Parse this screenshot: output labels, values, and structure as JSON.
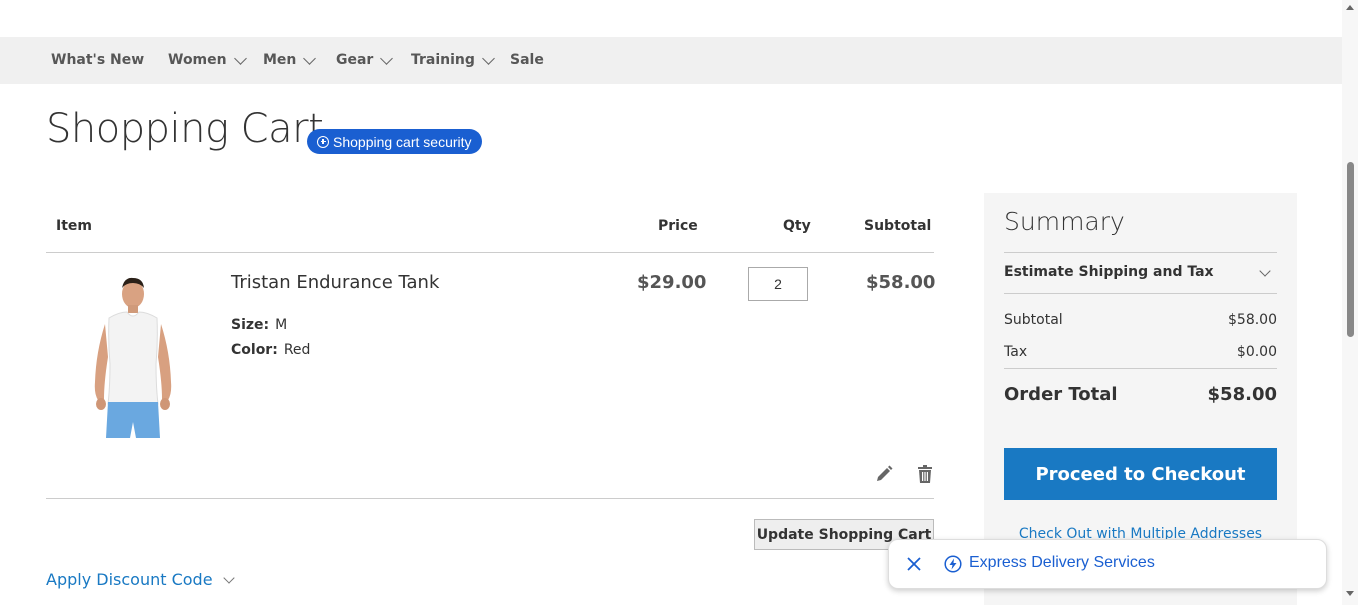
{
  "nav": {
    "items": [
      {
        "label": "What's New",
        "has_dropdown": false
      },
      {
        "label": "Women",
        "has_dropdown": true
      },
      {
        "label": "Men",
        "has_dropdown": true
      },
      {
        "label": "Gear",
        "has_dropdown": true
      },
      {
        "label": "Training",
        "has_dropdown": true
      },
      {
        "label": "Sale",
        "has_dropdown": false
      }
    ]
  },
  "page": {
    "title": "Shopping Cart",
    "security_badge": "Shopping cart security"
  },
  "cart": {
    "headers": {
      "item": "Item",
      "price": "Price",
      "qty": "Qty",
      "subtotal": "Subtotal"
    },
    "items": [
      {
        "name": "Tristan Endurance Tank",
        "options": [
          {
            "label": "Size:",
            "value": "M"
          },
          {
            "label": "Color:",
            "value": "Red"
          }
        ],
        "price": "$29.00",
        "qty": "2",
        "subtotal": "$58.00"
      }
    ],
    "update_button": "Update Shopping Cart",
    "discount_link": "Apply Discount Code"
  },
  "summary": {
    "title": "Summary",
    "estimate_label": "Estimate Shipping and Tax",
    "subtotal_label": "Subtotal",
    "subtotal_value": "$58.00",
    "tax_label": "Tax",
    "tax_value": "$0.00",
    "order_total_label": "Order Total",
    "order_total_value": "$58.00",
    "checkout_button": "Proceed to Checkout",
    "multi_address_link": "Check Out with Multiple Addresses"
  },
  "express": {
    "label": "Express Delivery Services"
  },
  "colors": {
    "link": "#1979c3",
    "checkout": "#1979c3",
    "badge": "#1a5fd1",
    "nav_bg": "#f0f0f0",
    "summary_bg": "#f5f5f5"
  },
  "icons": [
    "chevron-down-icon",
    "plus-circle-icon",
    "pencil-icon",
    "trash-icon",
    "close-icon",
    "bolt-icon"
  ]
}
